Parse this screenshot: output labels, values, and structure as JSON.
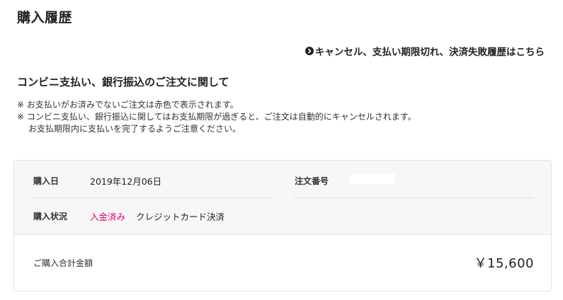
{
  "page": {
    "title": "購入履歴"
  },
  "links": {
    "cancel_history": "キャンセル、支払い期限切れ、決済失敗履歴はこちら"
  },
  "section": {
    "heading": "コンビニ支払い、銀行振込のご注文に関して",
    "notes": [
      "※ お支払いがお済みでないご注文は赤色で表示されます。",
      "※ コンビニ支払い、銀行振込に関してはお支払期限が過ぎると、ご注文は自動的にキャンセルされます。",
      "お支払期限内に支払いを完了するようご注意ください。"
    ]
  },
  "order": {
    "purchase_date_label": "購入日",
    "purchase_date": "2019年12月06日",
    "order_number_label": "注文番号",
    "status_label": "購入状況",
    "payment_status": "入金済み",
    "payment_method": "クレジットカード決済",
    "total_label": "ご購入合計金額",
    "total_value": "￥15,600"
  },
  "colors": {
    "status_paid": "#e6007e",
    "card_header_bg": "#f7f7f7",
    "border": "#e3e3e3"
  },
  "icons": {
    "cancel_link_icon": "chevron-right-circle-icon"
  }
}
